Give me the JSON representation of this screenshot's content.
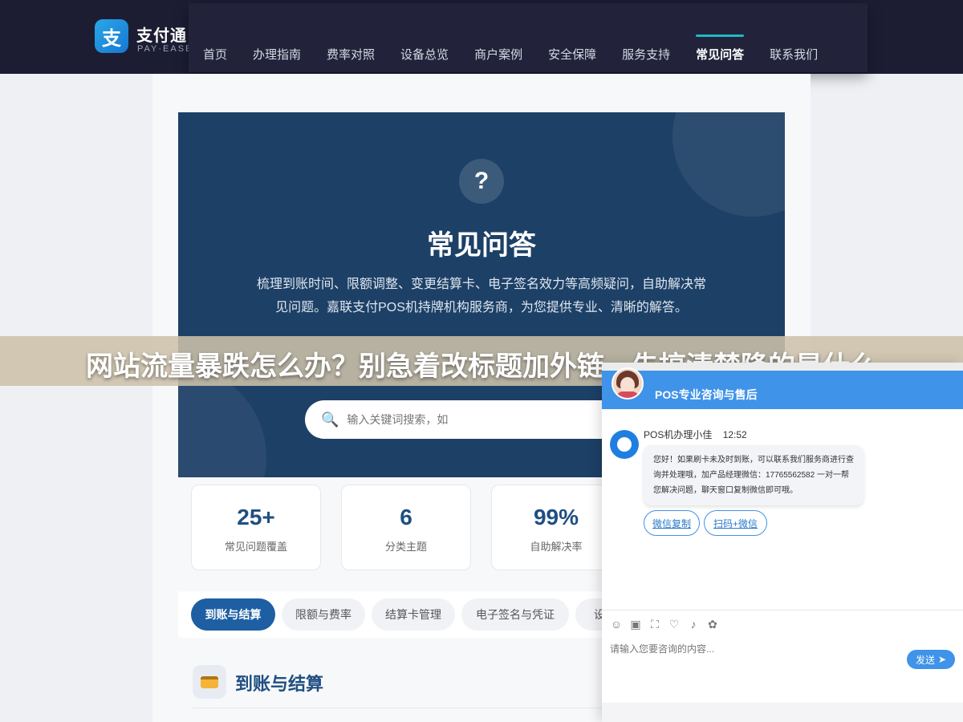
{
  "brand": {
    "mark": "支",
    "name": "支付通",
    "sub": "PAY·EASE"
  },
  "nav": {
    "items": [
      {
        "label": "首页"
      },
      {
        "label": "办理指南"
      },
      {
        "label": "费率对照"
      },
      {
        "label": "设备总览"
      },
      {
        "label": "商户案例"
      },
      {
        "label": "安全保障"
      },
      {
        "label": "服务支持"
      },
      {
        "label": "常见问答",
        "active": true
      },
      {
        "label": "联系我们"
      }
    ]
  },
  "hero": {
    "icon": "?",
    "title": "常见问答",
    "description": "梳理到账时间、限额调整、变更结算卡、电子签名效力等高频疑问，自助解决常见问题。嘉联支付POS机持牌机构服务商，为您提供专业、清晰的解答。",
    "search_placeholder": "输入关键词搜索，如"
  },
  "stats": [
    {
      "num": "25+",
      "label": "常见问题覆盖"
    },
    {
      "num": "6",
      "label": "分类主题"
    },
    {
      "num": "99%",
      "label": "自助解决率"
    }
  ],
  "tabs": [
    {
      "label": "到账与结算",
      "active": true
    },
    {
      "label": "限额与费率"
    },
    {
      "label": "结算卡管理"
    },
    {
      "label": "电子签名与凭证"
    },
    {
      "label": "设"
    }
  ],
  "section": {
    "title": "到账与结算",
    "icon": "card-icon"
  },
  "banner": {
    "text": "网站流量暴跌怎么办？别急着改标题加外链，先搞清楚降的是什么"
  },
  "chat": {
    "title": "POS专业咨询与售后",
    "sender": "POS机办理小佳",
    "time": "12:52",
    "message": "您好！如果刷卡未及时到账，可以联系我们服务商进行查询并处理哦，加产品经理微信：17765562582 一对一帮您解决问题，聊天窗口复制微信即可哦。",
    "actions": [
      "微信复制",
      "扫码+微信"
    ],
    "input_placeholder": "请输入您要咨询的内容...",
    "send_label": "发送",
    "accent": "#3f93e8"
  },
  "colors": {
    "header_bg": "#1c1d33",
    "hero_bg": "#1d4066",
    "accent": "#22b8c9",
    "primary": "#1e5fa3"
  }
}
